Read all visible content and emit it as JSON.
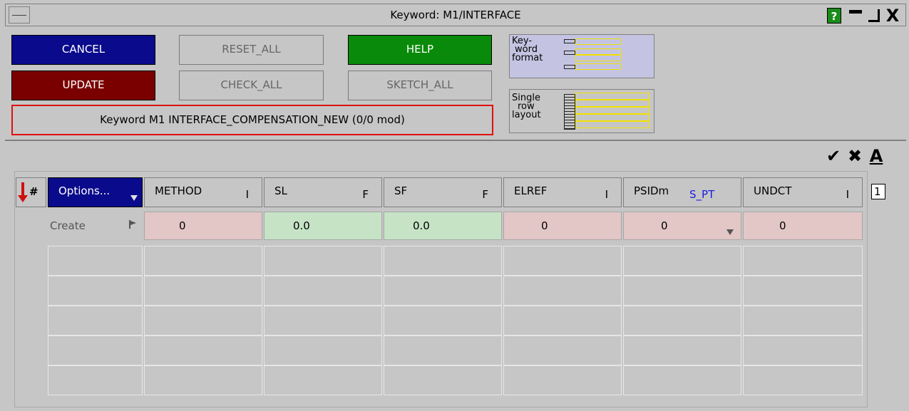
{
  "window": {
    "title": "Keyword: M1/INTERFACE",
    "help_glyph": "?",
    "close_glyph": "X"
  },
  "buttons": {
    "cancel": "CANCEL",
    "update": "UPDATE",
    "reset_all": "RESET_ALL",
    "check_all": "CHECK_ALL",
    "help": "HELP",
    "sketch_all": "SKETCH_ALL"
  },
  "keyword_status": "Keyword M1 INTERFACE_COMPENSATION_NEW (0/0 mod)",
  "format_panels": {
    "keyword_format": [
      "Key-",
      "word",
      "format"
    ],
    "single_row_layout": [
      "Single",
      "row",
      "layout"
    ]
  },
  "toolbar_icons": [
    "check-icon",
    "cross-icon",
    "font-a-icon"
  ],
  "toolbar_glyphs": [
    "✔",
    "✖",
    "A"
  ],
  "table": {
    "hash_label": "#",
    "options_label": "Options...",
    "columns": [
      {
        "name": "METHOD",
        "type": "I"
      },
      {
        "name": "SL",
        "type": "F"
      },
      {
        "name": "SF",
        "type": "F"
      },
      {
        "name": "ELREF",
        "type": "I"
      },
      {
        "name": "PSIDm",
        "type": "S_PT"
      },
      {
        "name": "UNDCT",
        "type": "I"
      }
    ],
    "create_row": {
      "label": "Create",
      "values": [
        "0",
        "0.0",
        "0.0",
        "0",
        "0",
        "0"
      ]
    },
    "empty_rows": 5,
    "row_count_field": "1"
  },
  "colors": {
    "background": "#c6c6c6",
    "cancel": "#0a0a8c",
    "update": "#7a0000",
    "help": "#0a8a0a",
    "integer_cell": "#e3c6c6",
    "float_cell": "#c6e3c6",
    "status_border": "#e01010",
    "format_panel": "#c4c4e2"
  }
}
